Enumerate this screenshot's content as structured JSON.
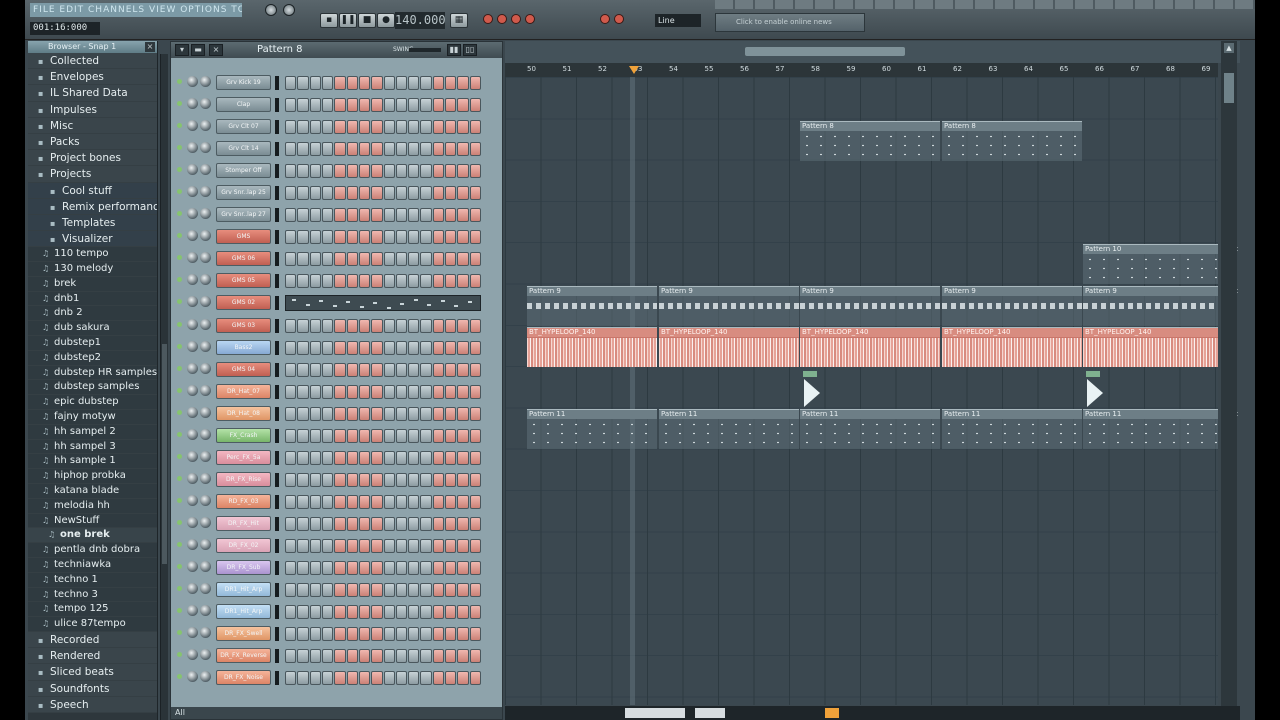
{
  "toolbar": {
    "menu_strip": "FILE EDIT CHANNELS VIEW OPTIONS TOOLS HELP",
    "time_display": "001:16:000",
    "tempo_display": "140.000",
    "snap_mode": "Line",
    "news_text": "Click to enable online news"
  },
  "browser": {
    "title": "Browser - Snap 1",
    "close_label": "×",
    "folders": [
      "Collected",
      "Envelopes",
      "IL Shared Data",
      "Impulses",
      "Misc",
      "Packs",
      "Project bones",
      "Projects"
    ],
    "project_subfolders": [
      "Cool stuff",
      "Remix performance",
      "Templates",
      "Visualizer"
    ],
    "files": [
      "110 tempo",
      "130 melody",
      "brek",
      "dnb1",
      "dnb 2",
      "dub sakura",
      "dubstep1",
      "dubstep2",
      "dubstep HR samples",
      "dubstep samples",
      "epic dubstep",
      "fajny motyw",
      "hh sampel 2",
      "hh sampel 3",
      "hh sample 1",
      "hiphop probka",
      "katana blade",
      "melodia hh",
      "NewStuff"
    ],
    "selected_file": "one brek",
    "files_after": [
      "pentla dnb dobra",
      "techniawka",
      "techno 1",
      "techno 3",
      "tempo 125",
      "ulice 87tempo"
    ],
    "folders_after": [
      "Recorded",
      "Rendered",
      "Sliced beats",
      "Soundfonts",
      "Speech"
    ]
  },
  "channel_rack": {
    "pattern_title": "Pattern 8",
    "swing_label": "SWING",
    "filter_label": "All",
    "channels": [
      {
        "name": "Grv Kick 19",
        "color": "grey",
        "steps": "grey-red"
      },
      {
        "name": "Clap",
        "color": "grey",
        "steps": "grey-red"
      },
      {
        "name": "Grv Clt 07",
        "color": "grey",
        "steps": "grey-red"
      },
      {
        "name": "Grv Clt 14",
        "color": "grey",
        "steps": "grey-red"
      },
      {
        "name": "Stomper Off",
        "color": "grey",
        "steps": "grey-red"
      },
      {
        "name": "Grv Snr..lap 25",
        "color": "grey",
        "steps": "grey-red"
      },
      {
        "name": "Grv Snr..lap 27",
        "color": "grey",
        "steps": "grey-red"
      },
      {
        "name": "GMS",
        "color": "red",
        "steps": "grey-red"
      },
      {
        "name": "GMS 06",
        "color": "red",
        "steps": "grey-red"
      },
      {
        "name": "GMS 05",
        "color": "red",
        "steps": "grey-red"
      },
      {
        "name": "GMS 02",
        "color": "red",
        "steps": "piano"
      },
      {
        "name": "GMS 03",
        "color": "red",
        "steps": "grey-red"
      },
      {
        "name": "Bass2",
        "color": "blue",
        "steps": "grey-red"
      },
      {
        "name": "GMS 04",
        "color": "red",
        "steps": "grey-red"
      },
      {
        "name": "DR_Hat_07",
        "color": "peach",
        "steps": "grey-red"
      },
      {
        "name": "DR_Hat_08",
        "color": "orange",
        "steps": "grey-red"
      },
      {
        "name": "FX_Crash",
        "color": "green",
        "steps": "grey-red"
      },
      {
        "name": "Perc_FX_5a",
        "color": "pink",
        "steps": "grey-red"
      },
      {
        "name": "DR_FX_Rise",
        "color": "pink",
        "steps": "grey-red"
      },
      {
        "name": "RD_FX_03",
        "color": "peach",
        "steps": "grey-red"
      },
      {
        "name": "DR_FX_Hit",
        "color": "lpink",
        "steps": "grey-red"
      },
      {
        "name": "DR_FX_02",
        "color": "lpink",
        "steps": "grey-red"
      },
      {
        "name": "DR_FX_Sub",
        "color": "lav",
        "steps": "grey-red"
      },
      {
        "name": "DR1_Hit_Arp",
        "color": "lblue",
        "steps": "grey-red"
      },
      {
        "name": "DR1_Hit_Arp",
        "color": "lblue",
        "steps": "grey-red"
      },
      {
        "name": "DR_FX_Swell",
        "color": "orange",
        "steps": "grey-red"
      },
      {
        "name": "DR_FX_Reverse",
        "color": "peach",
        "steps": "grey-red"
      },
      {
        "name": "DR_FX_Noise",
        "color": "peach",
        "steps": "grey-red"
      }
    ]
  },
  "playlist": {
    "ruler": [
      "50",
      "51",
      "52",
      "53",
      "54",
      "55",
      "56",
      "57",
      "58",
      "59",
      "60",
      "61",
      "62",
      "63",
      "64",
      "65",
      "66",
      "67",
      "68",
      "69"
    ],
    "clips": [
      {
        "label": "Pattern 8",
        "type": "pattern"
      },
      {
        "label": "Pattern 8",
        "type": "pattern"
      },
      {
        "label": "Pattern 10",
        "type": "pattern"
      },
      {
        "label": "Pat",
        "type": "pattern"
      },
      {
        "label": "Pattern 9",
        "type": "pattern"
      },
      {
        "label": "Pattern 9",
        "type": "pattern"
      },
      {
        "label": "Pattern 9",
        "type": "pattern"
      },
      {
        "label": "Pattern 9",
        "type": "pattern"
      },
      {
        "label": "Pattern 9",
        "type": "pattern"
      },
      {
        "label": "Pat",
        "type": "pattern"
      },
      {
        "label": "BT_HYPELOOP_140",
        "type": "audio"
      },
      {
        "label": "BT_HYPELOOP_140",
        "type": "audio"
      },
      {
        "label": "BT_HYPELOOP_140",
        "type": "audio"
      },
      {
        "label": "BT_HYPELOOP_140",
        "type": "audio"
      },
      {
        "label": "BT_HYPELOOP_140",
        "type": "audio"
      },
      {
        "label": "Pattern 11",
        "type": "pattern"
      },
      {
        "label": "Pattern 11",
        "type": "pattern"
      },
      {
        "label": "Pattern 11",
        "type": "pattern"
      },
      {
        "label": "Pattern 11",
        "type": "pattern"
      },
      {
        "label": "Pattern 11",
        "type": "pattern"
      },
      {
        "label": "Pat",
        "type": "pattern"
      }
    ]
  },
  "colors": {
    "accent": "#f0a23a",
    "background": "#3b474e"
  }
}
